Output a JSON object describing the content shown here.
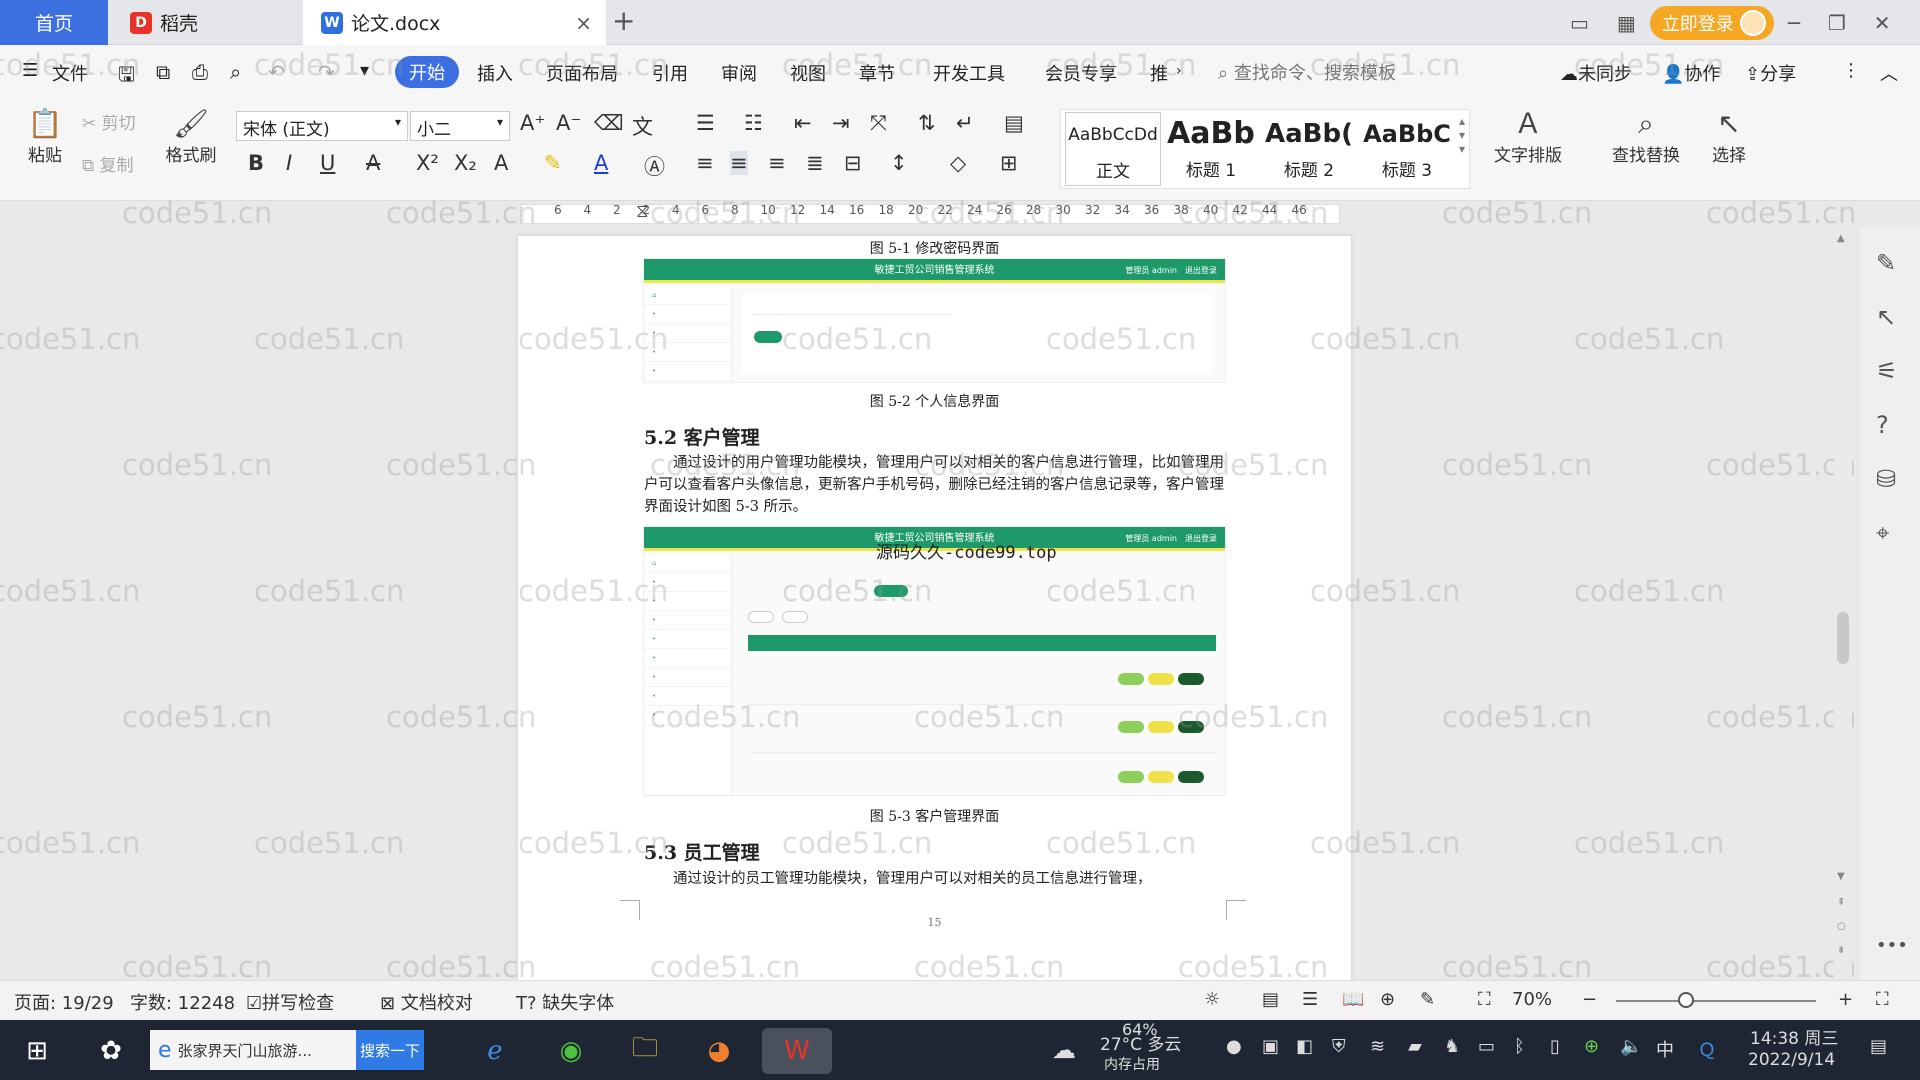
{
  "tabs": {
    "home": "首页",
    "daoke": "稻壳",
    "doc": "论文.docx",
    "login": "立即登录"
  },
  "menu": {
    "file": "文件",
    "start": "开始",
    "insert": "插入",
    "layout": "页面布局",
    "ref": "引用",
    "review": "审阅",
    "view": "视图",
    "chapter": "章节",
    "dev": "开发工具",
    "vip": "会员专享",
    "more": "推",
    "search_cmd": "查找命令、搜索模板",
    "sync": "未同步",
    "collab": "协作",
    "share": "分享"
  },
  "ribbon": {
    "paste": "粘贴",
    "cut": "剪切",
    "copy": "复制",
    "format_painter": "格式刷",
    "font_name": "宋体 (正文)",
    "font_size": "小二",
    "styles": [
      {
        "sample": "AaBbCcDd",
        "label": "正文"
      },
      {
        "sample": "AaBb",
        "label": "标题 1"
      },
      {
        "sample": "AaBb(",
        "label": "标题 2"
      },
      {
        "sample": "AaBbC",
        "label": "标题 3"
      }
    ],
    "text_layout": "文字排版",
    "find_replace": "查找替换",
    "select": "选择"
  },
  "ruler": [
    "6",
    "4",
    "2",
    "2",
    "4",
    "6",
    "8",
    "10",
    "12",
    "14",
    "16",
    "18",
    "20",
    "22",
    "24",
    "26",
    "28",
    "30",
    "32",
    "34",
    "36",
    "38",
    "40",
    "42",
    "44",
    "46"
  ],
  "doc": {
    "caption_51": "图 5-1 修改密码界面",
    "caption_52": "图 5-2 个人信息界面",
    "heading_52": "5.2 客户管理",
    "para_52": "通过设计的用户管理功能模块，管理用户可以对相关的客户信息进行管理，比如管理用户可以查看客户头像信息，更新客户手机号码，删除已经注销的客户信息记录等，客户管理界面设计如图 5-3 所示。",
    "caption_53": "图 5-3 客户管理界面",
    "heading_53": "5.3 员工管理",
    "para_53": "通过设计的员工管理功能模块，管理用户可以对相关的员工信息进行管理，",
    "page_number": "15",
    "overlay": "源码久久-code99.top",
    "shot_title": "敏捷工贸公司销售管理系统",
    "shot_user": "管理员 admin　退出登录"
  },
  "watermark_text": "code51.cn",
  "status": {
    "page": "页面: 19/29",
    "words": "字数: 12248",
    "spell": "拼写检查",
    "proof": "文档校对",
    "font_missing": "缺失字体",
    "zoom": "70%"
  },
  "taskbar": {
    "browser_title": "张家界天门山旅游...",
    "search_btn": "搜索一下",
    "weather": "27°C 多云",
    "memory": "64%",
    "memory_label": "内存占用",
    "ime": "中",
    "time": "14:38 周三",
    "date": "2022/9/14"
  },
  "colors": {
    "accent": "#3b6fe2",
    "login": "#f5a623",
    "shot_green": "#1e9a6a",
    "taskbar": "#1f2633"
  }
}
